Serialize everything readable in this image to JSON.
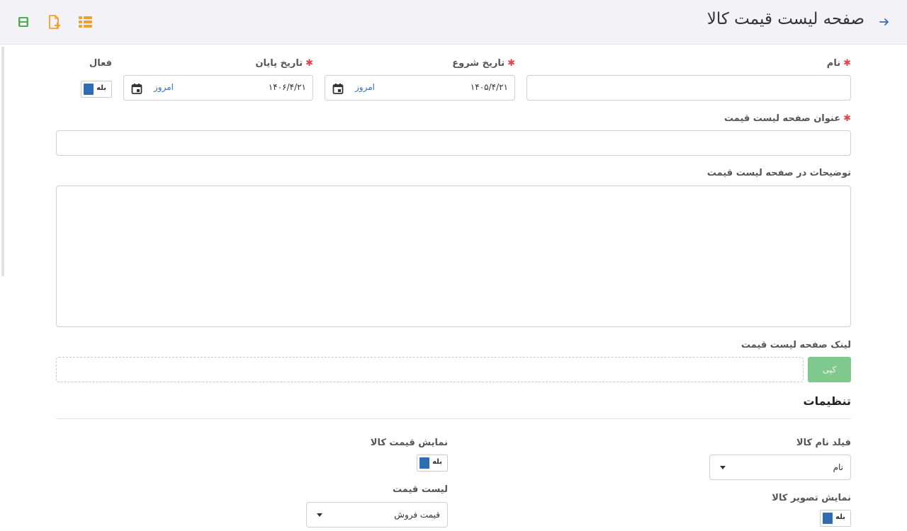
{
  "header": {
    "title": "صفحه لیست قیمت کالا",
    "back_icon": "arrow-right-icon",
    "toolbar": [
      {
        "icon": "list-icon",
        "color": "#f0a030"
      },
      {
        "icon": "add-file-icon",
        "color": "#f0a030"
      },
      {
        "icon": "save-icon",
        "color": "#4caf50"
      }
    ]
  },
  "form": {
    "name": {
      "label": "نام",
      "required": "✱",
      "value": ""
    },
    "start_date": {
      "label": "تاریخ شروع",
      "required": "✱",
      "value": "۱۴۰۵/۴/۲۱",
      "today": "امروز"
    },
    "end_date": {
      "label": "تاریخ پایان",
      "required": "✱",
      "value": "۱۴۰۶/۴/۲۱",
      "today": "امروز"
    },
    "active": {
      "label": "فعال",
      "toggle": "بله"
    },
    "page_title": {
      "label": "عنوان صفحه لیست قیمت",
      "required": "✱",
      "value": ""
    },
    "description": {
      "label": "توضیحات در صفحه لیست قیمت",
      "value": ""
    },
    "link": {
      "label": "لینک صفحه لیست قیمت",
      "value": "",
      "copy_label": "کپی"
    }
  },
  "settings": {
    "title": "تنظیمات",
    "product_name_field": {
      "label": "فیلد نام کالا",
      "value": "نام"
    },
    "show_image": {
      "label": "نمایش تصویر کالا",
      "toggle": "بله"
    },
    "show_price": {
      "label": "نمایش قیمت کالا",
      "toggle": "بله"
    },
    "price_list": {
      "label": "لیست قیمت",
      "value": "قیمت فروش"
    }
  },
  "colors": {
    "accent": "#2e6db0",
    "required": "#e0454f",
    "copy_button": "#7fc98f",
    "toolbar_orange": "#f0a030",
    "toolbar_green": "#4caf50"
  }
}
